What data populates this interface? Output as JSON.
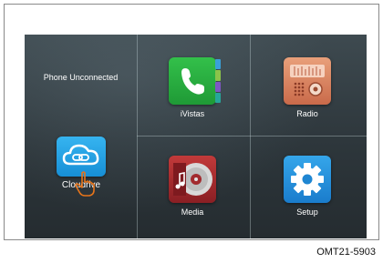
{
  "status": {
    "phone_connection": "Phone Unconnected"
  },
  "tiles": {
    "cloudrive": {
      "label": "Cloudrive",
      "icon": "cloud-link-icon"
    },
    "ivistas": {
      "label": "iVistas",
      "icon": "phone-icon"
    },
    "radio": {
      "label": "Radio",
      "icon": "radio-icon"
    },
    "media": {
      "label": "Media",
      "icon": "media-disc-icon"
    },
    "setup": {
      "label": "Setup",
      "icon": "gear-icon"
    }
  },
  "figure_code": "OMT21-5903",
  "colors": {
    "screen_bg": "#2d363b",
    "ivistas": "#2bb041",
    "radio": "#d98a66",
    "media": "#a22a2e",
    "setup": "#2590dc",
    "cloudrive": "#29a3e6",
    "hand": "#e8751a"
  }
}
